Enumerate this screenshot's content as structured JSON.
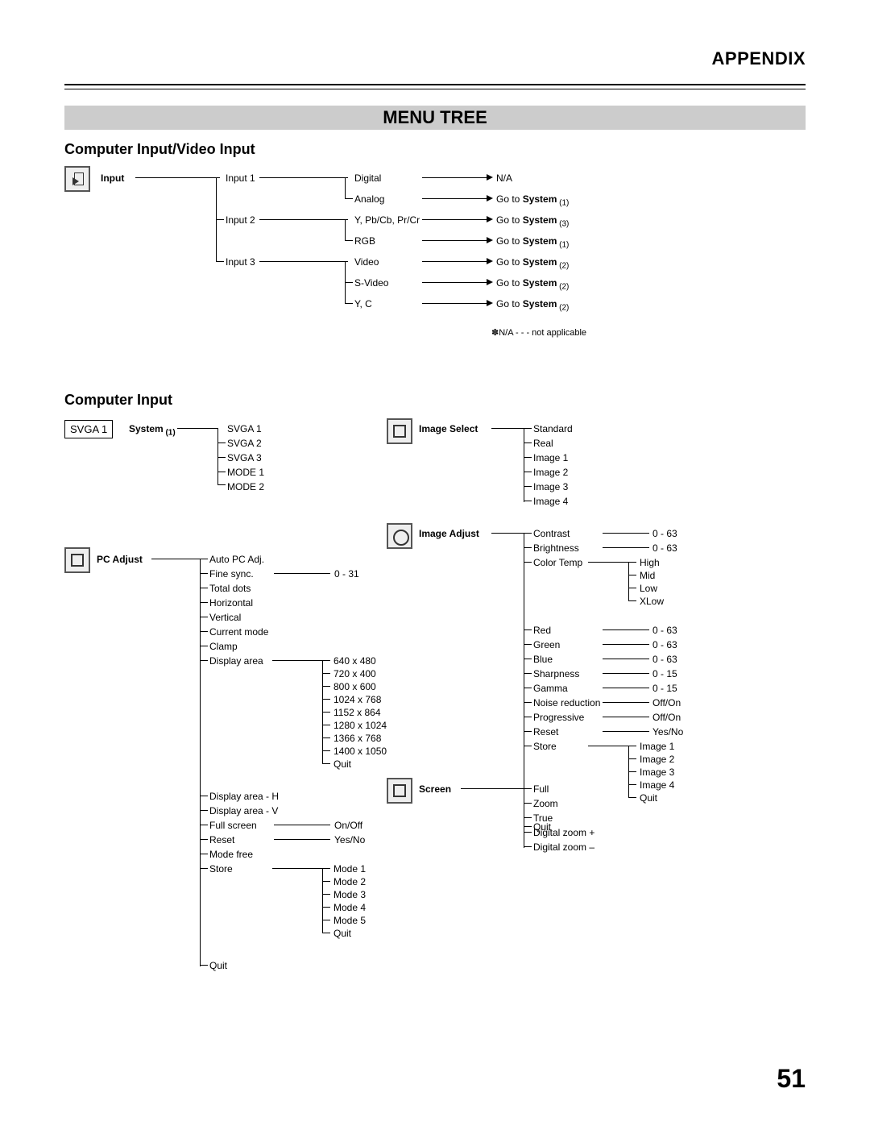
{
  "header": {
    "appendix": "APPENDIX",
    "menu_tree": "MENU TREE"
  },
  "page_number": "51",
  "section1": {
    "title": "Computer Input/Video Input",
    "root": "Input",
    "inputs": [
      "Input 1",
      "Input 2",
      "Input 3"
    ],
    "col2": [
      "Digital",
      "Analog",
      "Y, Pb/Cb, Pr/Cr",
      "RGB",
      "Video",
      "S-Video",
      "Y, C"
    ],
    "targets_prefix": "Go to ",
    "targets_bold": "System",
    "targets_suffix": [
      " (1)",
      " (3)",
      " (1)",
      " (2)",
      " (2)",
      " (2)"
    ],
    "na": "N/A",
    "footnote": "✽N/A - - - not applicable"
  },
  "section2": {
    "title": "Computer Input",
    "system_label": "System",
    "system_sub": " (1)",
    "svga_box": "SVGA 1",
    "system_items": [
      "SVGA 1",
      "SVGA 2",
      "SVGA 3",
      "MODE 1",
      "MODE 2"
    ],
    "pc_adjust_label": "PC Adjust",
    "pc_adjust_items": [
      "Auto PC Adj.",
      "Fine sync.",
      "Total dots",
      "Horizontal",
      "Vertical",
      "Current mode",
      "Clamp",
      "Display area",
      "Display area - H",
      "Display area - V",
      "Full screen",
      "Reset",
      "Mode free",
      "Store",
      "Quit"
    ],
    "pc_adjust_values": {
      "fine_sync": "0 - 31",
      "full_screen": "On/Off",
      "reset": "Yes/No"
    },
    "display_area_items": [
      "640 x 480",
      "720 x 400",
      "800 x 600",
      "1024 x 768",
      "1152 x 864",
      "1280 x 1024",
      "1366 x 768",
      "1400 x 1050",
      "Quit"
    ],
    "store_items": [
      "Mode 1",
      "Mode 2",
      "Mode 3",
      "Mode 4",
      "Mode 5",
      "Quit"
    ],
    "image_select_label": "Image Select",
    "image_select_items": [
      "Standard",
      "Real",
      "Image 1",
      "Image 2",
      "Image 3",
      "Image 4"
    ],
    "image_adjust_label": "Image Adjust",
    "image_adjust_items": [
      "Contrast",
      "Brightness",
      "Color Temp",
      "Red",
      "Green",
      "Blue",
      "Sharpness",
      "Gamma",
      "Noise reduction",
      "Progressive",
      "Reset",
      "Store",
      "Quit"
    ],
    "image_adjust_values": [
      "0 - 63",
      "0 - 63",
      "0 - 63",
      "0 - 63",
      "0 - 63",
      "0 - 15",
      "0 - 15",
      "Off/On",
      "Off/On",
      "Yes/No"
    ],
    "color_temp_items": [
      "High",
      "Mid",
      "Low",
      "XLow"
    ],
    "store_image_items": [
      "Image 1",
      "Image 2",
      "Image 3",
      "Image 4",
      "Quit"
    ],
    "screen_label": "Screen",
    "screen_items": [
      "Full",
      "Zoom",
      "True",
      "Digital zoom +",
      "Digital zoom –"
    ]
  }
}
